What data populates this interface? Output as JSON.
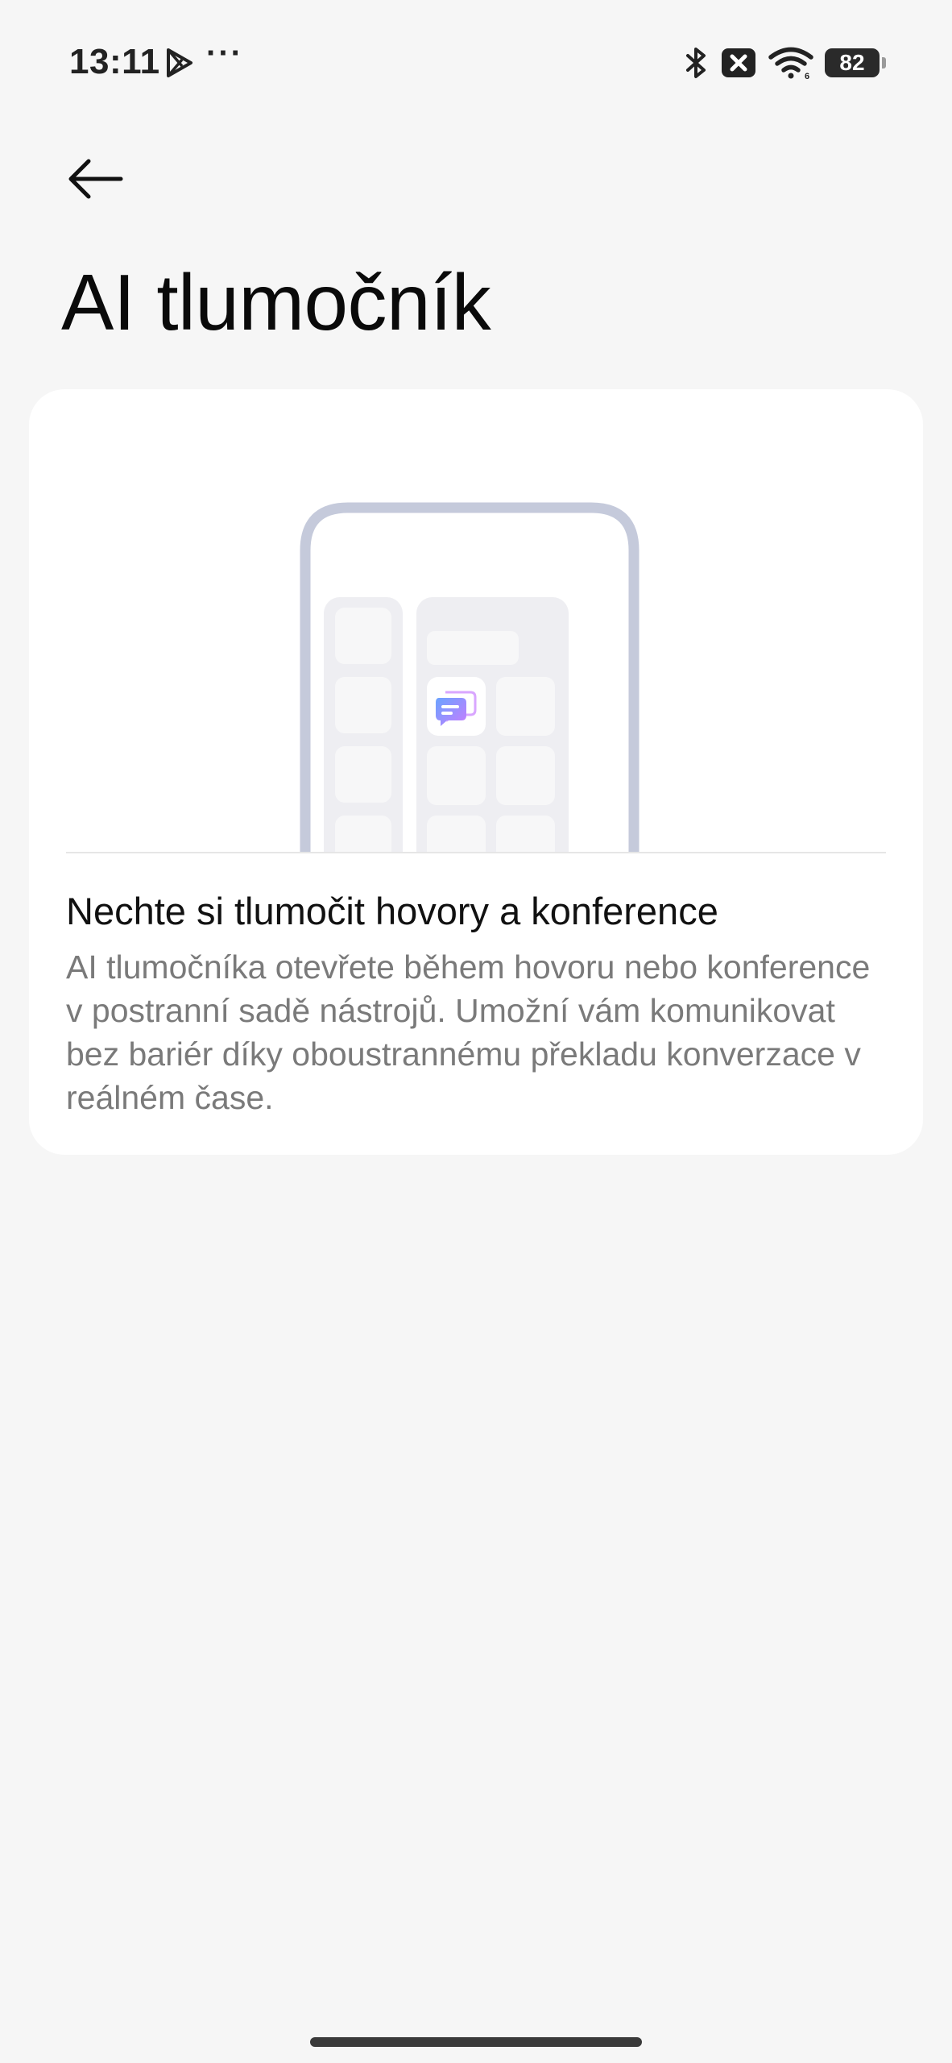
{
  "status_bar": {
    "time": "13:11",
    "more_indicator": "···",
    "battery_level": "82",
    "icons": [
      "play-store-icon",
      "bluetooth-icon",
      "no-sim-icon",
      "wifi-icon",
      "battery-icon"
    ]
  },
  "header": {
    "back_icon": "arrow-left-icon",
    "title": "AI tlumočník"
  },
  "card": {
    "illustration_icon": "chat-translate-icon",
    "heading": "Nechte si tlumočit hovory a konference",
    "body": "AI tlumočníka otevřete během hovoru nebo konference v postranní sadě nástrojů. Umožní vám komunikovat bez bariér díky oboustrannému překladu konverzace v reálném čase."
  },
  "colors": {
    "background": "#f6f6f6",
    "card": "#ffffff",
    "phone_frame": "#c5cadb",
    "panel": "#eeeef2",
    "tile": "#f6f6f7",
    "icon_accent_start": "#6aa3ff",
    "icon_accent_end": "#c77dff"
  }
}
